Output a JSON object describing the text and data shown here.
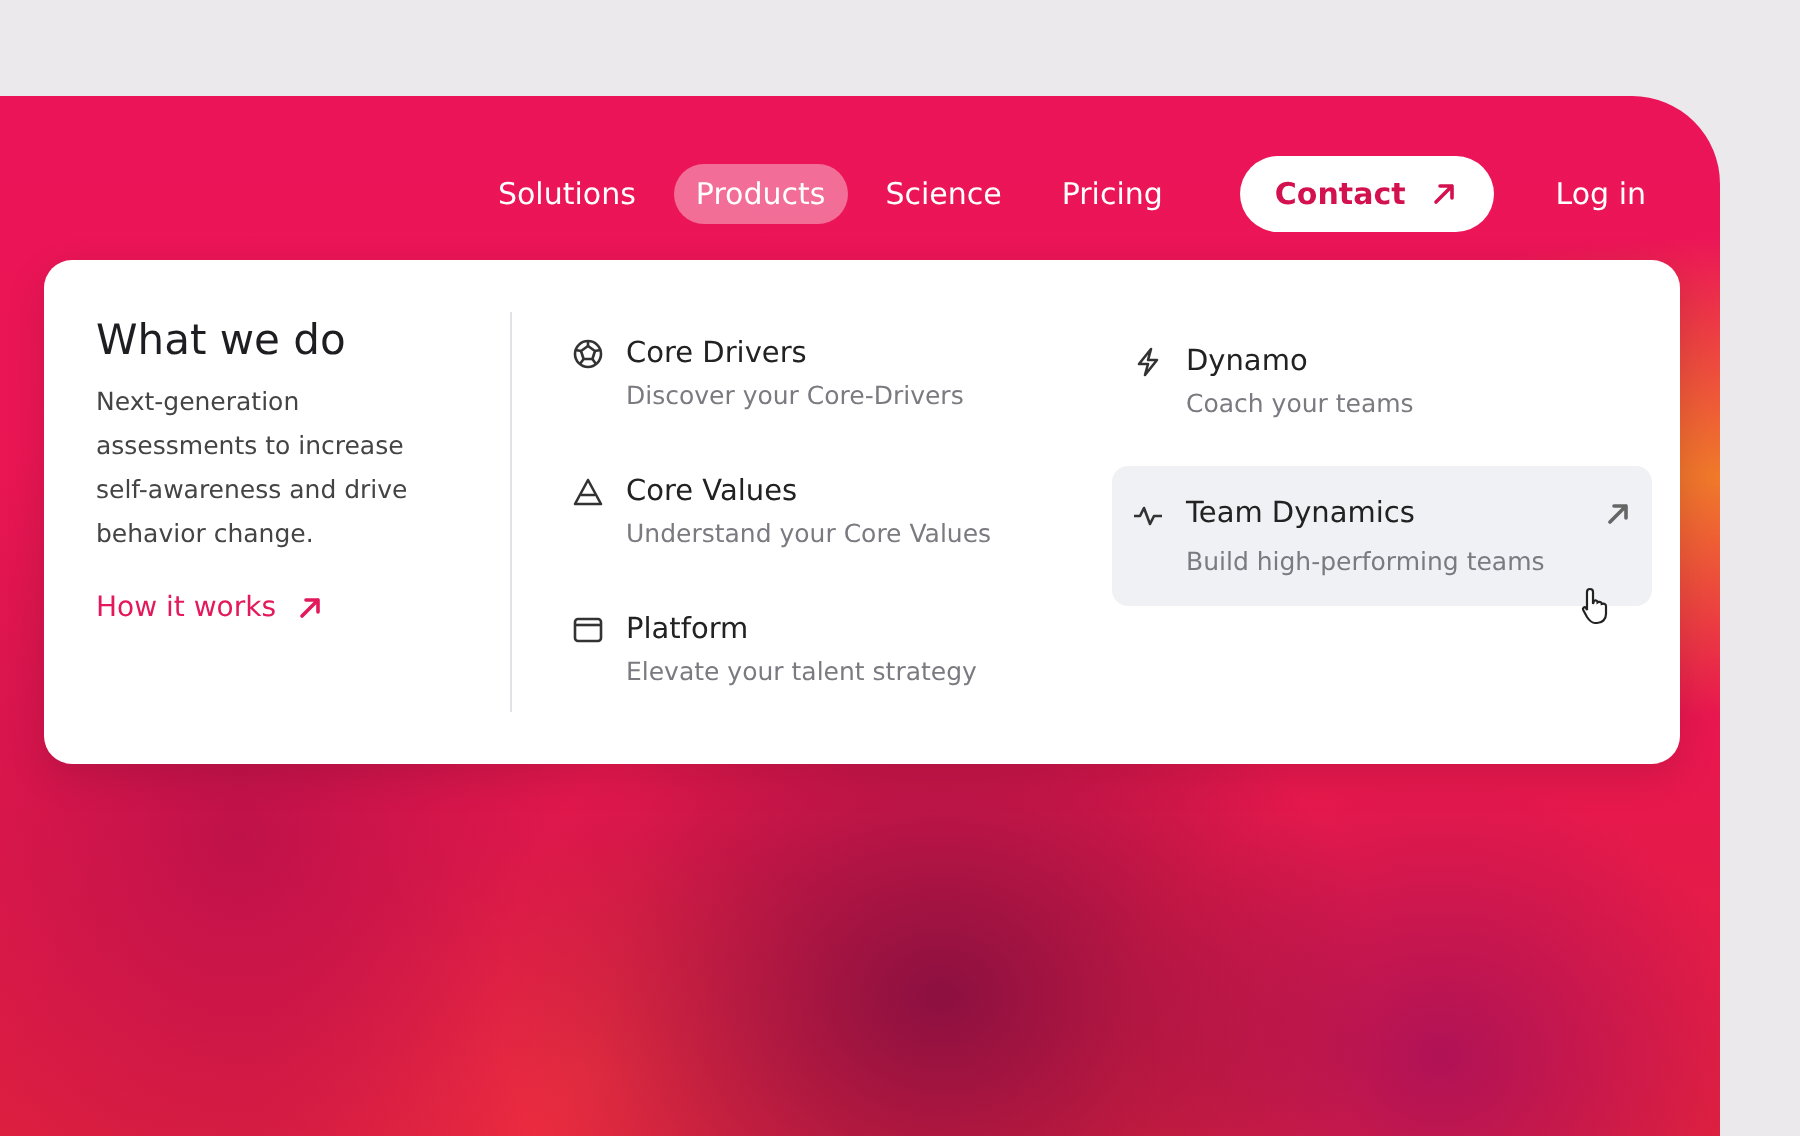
{
  "nav": {
    "links": [
      {
        "label": "Solutions",
        "selected": false
      },
      {
        "label": "Products",
        "selected": true
      },
      {
        "label": "Science",
        "selected": false
      },
      {
        "label": "Pricing",
        "selected": false
      }
    ],
    "contact_button": "Contact",
    "login": "Log in"
  },
  "dropdown": {
    "intro": {
      "title": "What we do",
      "description": "Next-generation assessments to increase self-awareness and drive behavior change.",
      "link": "How it works"
    },
    "columns": [
      [
        {
          "title": "Core Drivers",
          "subtitle": "Discover your Core-Drivers",
          "selected": false
        },
        {
          "title": "Core Values",
          "subtitle": "Understand your Core Values",
          "selected": false
        },
        {
          "title": "Platform",
          "subtitle": "Elevate your talent strategy",
          "selected": false
        }
      ],
      [
        {
          "title": "Dynamo",
          "subtitle": "Coach your teams",
          "selected": false
        },
        {
          "title": "Team Dynamics",
          "subtitle": "Build high-performing teams",
          "selected": true
        }
      ]
    ]
  }
}
